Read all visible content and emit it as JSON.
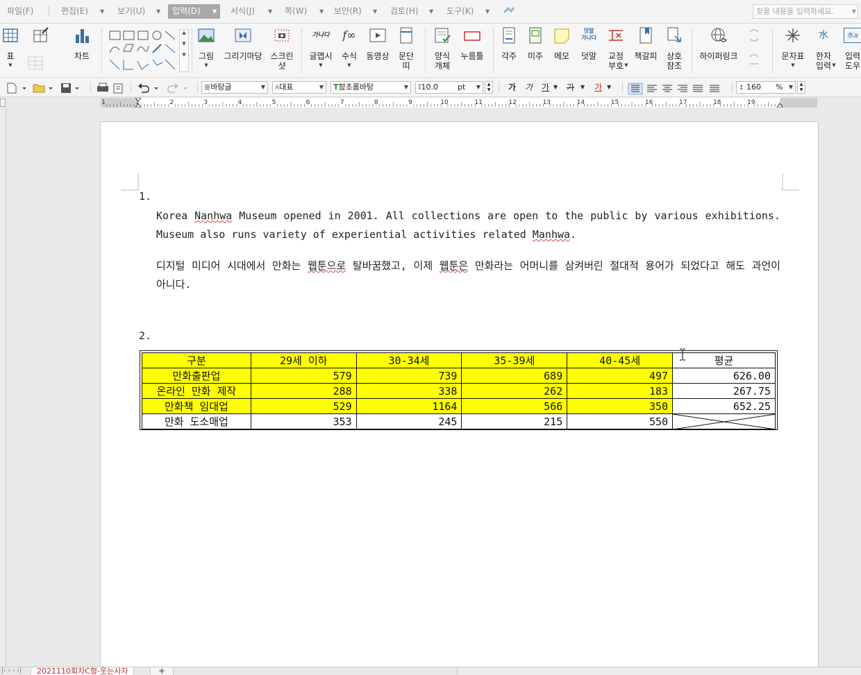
{
  "menubar": {
    "items": [
      "파일(F)",
      "편집(E)",
      "보기(U)",
      "입력(D)",
      "서식(J)",
      "쪽(W)",
      "보안(R)",
      "검토(H)",
      "도구(K)"
    ],
    "search_placeholder": "찾을 내용을 입력하세요."
  },
  "ribbon": {
    "table_label": "표",
    "chart_label": "차트",
    "picture_label": "그림",
    "drawing_label": "그리기마당",
    "screenshot_label": "스크린\n샷",
    "wordart_label": "글맵시",
    "equation_label": "수식",
    "video_label": "동영상",
    "paragraph_label": "문단\n띠",
    "form_label": "양식\n개체",
    "button_label": "누름틀",
    "footnote_label": "각주",
    "endnote_label": "미주",
    "memo_label": "메모",
    "overlay_label": "덧말",
    "proof_label": "교정\n부호",
    "bookmark_label": "책갈피",
    "crossref_label": "상호\n참조",
    "hyperlink_label": "하이퍼링크",
    "symbol_label": "문자표",
    "hanja_label": "한자\n입력",
    "input_helper_label": "입력\n도우",
    "overlay_icon_text": "덧말\n가나다",
    "wordart_icon_text": "가나다",
    "equation_icon_text": "f∞",
    "hanja_icon_text": "水",
    "input_icon_text": "水a"
  },
  "format": {
    "style": "바탕글",
    "lang": "대표",
    "font": "함초롬바탕",
    "size": "10.0",
    "size_unit": "pt",
    "bold": "가",
    "italic": "가",
    "underline": "가",
    "strike": "가",
    "color_text": "가",
    "zoom": "160",
    "zoom_unit": "%",
    "lang_prefix": "A",
    "font_prefix": "T"
  },
  "ruler": {
    "marks": [
      "1",
      "1",
      "2",
      "3",
      "4",
      "5",
      "6",
      "7",
      "8",
      "9",
      "10",
      "11",
      "12",
      "13",
      "14",
      "15",
      "16",
      "17",
      "18",
      "19"
    ]
  },
  "document": {
    "item1_num": "1.",
    "para1_parts": [
      "Korea ",
      "Nanhwa",
      " Museum opened in 2001. All collections are open to the public by various exhibitions. Museum also runs variety of experiential activities related ",
      "Manhwa",
      "."
    ],
    "para2_parts": [
      "디지털 미디어 시대에서 만화는 ",
      "웹툰으로",
      " 탈바꿈했고, 이제 ",
      "웹툰은",
      " 만화라는 어머니를 삼켜버린 절대적 용어가 되었다고 해도 과언이 아니다."
    ],
    "item2_num": "2.",
    "table": {
      "headers": [
        "구분",
        "29세 이하",
        "30-34세",
        "35-39세",
        "40-45세",
        "평균"
      ],
      "rows": [
        [
          "만화출판업",
          "579",
          "739",
          "689",
          "497",
          "626.00"
        ],
        [
          "온라인 만화 제작",
          "288",
          "338",
          "262",
          "183",
          "267.75"
        ],
        [
          "만화책 임대업",
          "529",
          "1164",
          "566",
          "350",
          "652.25"
        ],
        [
          "만화 도소매업",
          "353",
          "245",
          "215",
          "550",
          ""
        ]
      ]
    }
  },
  "status": {
    "sheet_tab": "2021110회차C형-웃는사자",
    "add_tab": "+",
    "nav": "|‹ ‹ › ›|"
  },
  "colors": {
    "highlight": "#ffff00",
    "active_menu": "#a8a8a8",
    "tab_text": "#b03030"
  }
}
